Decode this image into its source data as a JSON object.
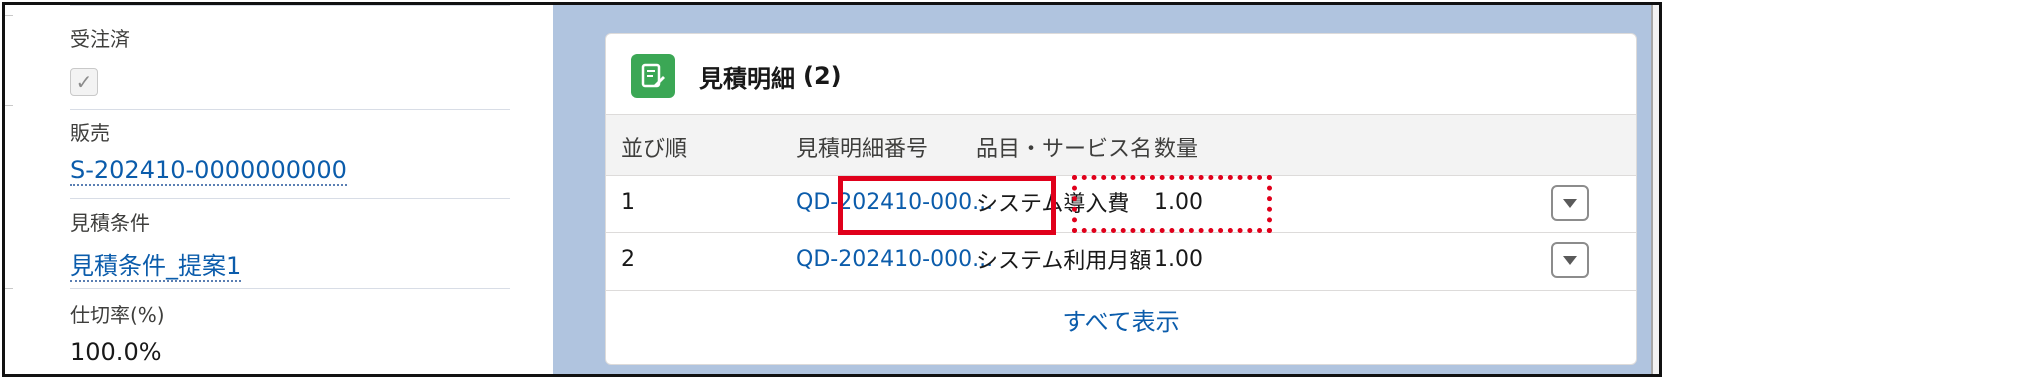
{
  "left_fields": [
    {
      "label": "受注済",
      "type": "checkbox",
      "checked": true
    },
    {
      "label": "販売",
      "value": "S-202410-0000000000",
      "type": "link"
    },
    {
      "label": "見積条件",
      "value": "見積条件_提案1",
      "type": "link"
    },
    {
      "label": "仕切率(%)",
      "value": "100.0%",
      "type": "text"
    }
  ],
  "checkbox_glyph": "✓",
  "related_list": {
    "title": "見積明細",
    "count": "(2)",
    "icon": "quote-line-item-icon",
    "icon_color": "#3ba755",
    "columns": [
      "並び順",
      "見積明細番号",
      "品目・サービス名",
      "数量"
    ],
    "rows": [
      {
        "order": "1",
        "number": "QD-202410-000...",
        "item": "システム導入費",
        "qty": "1.00"
      },
      {
        "order": "2",
        "number": "QD-202410-000...",
        "item": "システム利用月額",
        "qty": "1.00"
      }
    ],
    "view_all": "すべて表示"
  },
  "colors": {
    "background": "#b0c4df",
    "link": "#0b5cab",
    "highlight": "#e0001b"
  },
  "highlights": [
    {
      "target": "row-1-number",
      "style": "solid"
    },
    {
      "target": "row-1-item",
      "style": "dotted"
    }
  ]
}
